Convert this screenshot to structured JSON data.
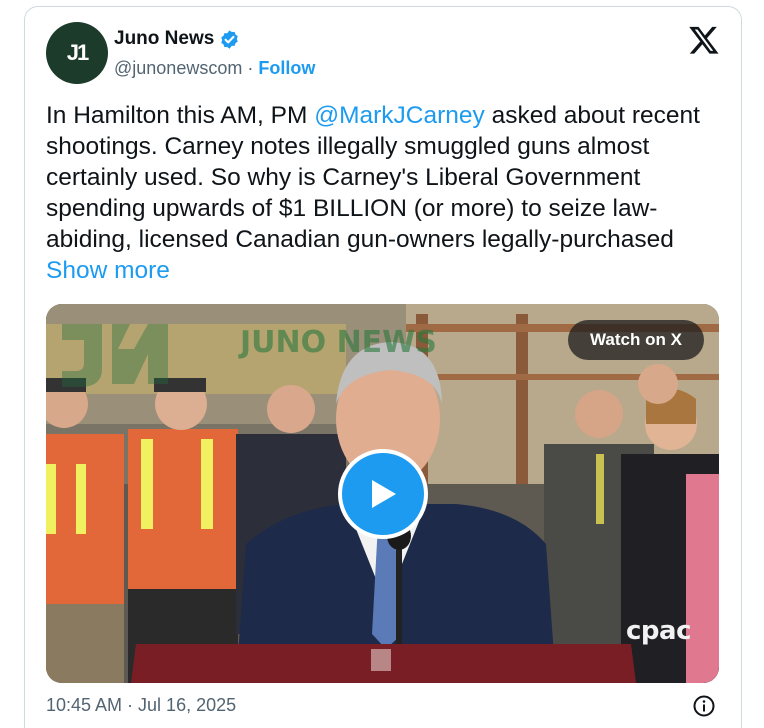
{
  "account": {
    "avatar_text": "J1",
    "display_name": "Juno News",
    "handle": "@junonewscom",
    "separator": "·",
    "follow_label": "Follow"
  },
  "tweet": {
    "text_before": "In Hamilton this AM, PM ",
    "mention": "@MarkJCarney",
    "text_after": " asked about recent shootings. Carney notes illegally smuggled guns almost certainly used. So why is Carney's Liberal Government spending upwards of $1 BILLION (or more) to seize law-abiding, licensed Canadian gun-owners legally-purchased ",
    "show_more": "Show more"
  },
  "media": {
    "watch_label": "Watch on X",
    "channel_logo": "cpac",
    "watermark_text": "JUNO NEWS"
  },
  "footer": {
    "timestamp": "10:45 AM · Jul 16, 2025"
  },
  "icons": {
    "verified": "verified-badge-icon",
    "platform": "x-logo-icon",
    "play": "play-icon",
    "info": "info-icon"
  },
  "colors": {
    "accent": "#1d9bf0",
    "text": "#0f1419",
    "secondary": "#536471",
    "avatar_bg": "#1d3b2a"
  }
}
